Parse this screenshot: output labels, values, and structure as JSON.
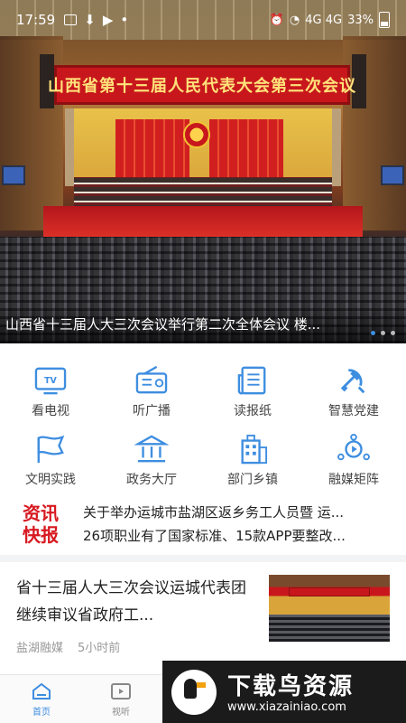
{
  "status_bar": {
    "time": "17:59",
    "signal_text": "4G 4G",
    "battery": "33%"
  },
  "hero": {
    "banner_text": "山西省第十三届人民代表大会第三次会议",
    "caption": "山西省十三届人大三次会议举行第二次全体会议 楼...",
    "page_index": 1,
    "page_count": 3
  },
  "grid": [
    {
      "label": "看电视",
      "icon": "tv-icon"
    },
    {
      "label": "听广播",
      "icon": "radio-icon"
    },
    {
      "label": "读报纸",
      "icon": "newspaper-icon"
    },
    {
      "label": "智慧党建",
      "icon": "party-emblem-icon"
    },
    {
      "label": "文明实践",
      "icon": "flag-icon"
    },
    {
      "label": "政务大厅",
      "icon": "government-building-icon"
    },
    {
      "label": "部门乡镇",
      "icon": "office-building-icon"
    },
    {
      "label": "融媒矩阵",
      "icon": "network-icon"
    }
  ],
  "news_flash": {
    "logo_line1": "资讯",
    "logo_line2": "快报",
    "items": [
      "关于举办运城市盐湖区返乡务工人员暨 运...",
      "26项职业有了国家标准、15款APP要整改..."
    ]
  },
  "article": {
    "title": "省十三届人大三次会议运城代表团继续审议省政府工...",
    "source": "盐湖融媒",
    "time": "5小时前"
  },
  "bottom_nav": {
    "home": "首页",
    "video": "视听"
  },
  "watermark": {
    "title": "下载鸟资源",
    "url": "www.xiazainiao.com"
  },
  "colors": {
    "accent": "#3e8ee0",
    "flash_red": "#d71920"
  }
}
